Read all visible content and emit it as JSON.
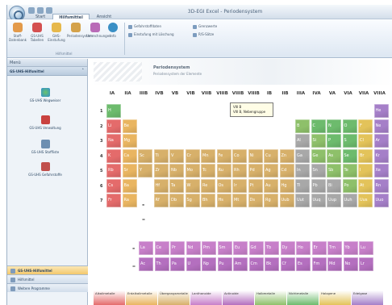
{
  "window": {
    "title": "3D-EGI Excel - Periodensystem"
  },
  "tabs": [
    "Start",
    "Hilfsmittel",
    "Ansicht"
  ],
  "ribbon": {
    "buttons": [
      "Stoff-Datenbank",
      "GS-UHS Tabellen",
      "GHS-Einstufung",
      "Periodensystem",
      "Umrechnungen",
      "Info"
    ],
    "small_buttons": [
      "Gefahrstoffdaten",
      "Einstufung mit Löschung",
      "Grenzwerte",
      "R/S-Sätze",
      "Datenblätter"
    ],
    "group_label": "Hilfsmittel"
  },
  "sidebar": {
    "header": "Menü",
    "category": "GS-UHS-Hilfsmittel",
    "items": [
      "GS-UHS Wegweiser",
      "GS-UHS Verwaltung",
      "GS-UHS Stoffliste",
      "GS-UHS Gefahrstoffe"
    ],
    "nav": [
      "GS-UHS-Hilfsmittel",
      "Hilfsmittel",
      "Weitere Programme"
    ]
  },
  "main": {
    "title": "Periodensystem",
    "subtitle": "Periodensystem der Elemente",
    "tooltip_line1": "VIII B",
    "tooltip_line2": "VIII B, Nebengruppe"
  },
  "table": {
    "groups": [
      "IA",
      "IIA",
      "IIIB",
      "IVB",
      "VB",
      "VIB",
      "VIIB",
      "VIIIB",
      "VIIIB",
      "VIIIB",
      "IB",
      "IIB",
      "IIIA",
      "IVA",
      "VA",
      "VIA",
      "VIIA",
      "VIIIA"
    ],
    "periods": [
      "1",
      "2",
      "3",
      "4",
      "5",
      "6",
      "7"
    ],
    "elements": [
      [
        "H",
        1,
        1,
        "nonmetal"
      ],
      [
        "He",
        1,
        18,
        "noble"
      ],
      [
        "Li",
        2,
        1,
        "alkali"
      ],
      [
        "Be",
        2,
        2,
        "alkaline"
      ],
      [
        "B",
        2,
        13,
        "metalloid"
      ],
      [
        "C",
        2,
        14,
        "nonmetal"
      ],
      [
        "N",
        2,
        15,
        "nonmetal"
      ],
      [
        "O",
        2,
        16,
        "nonmetal"
      ],
      [
        "F",
        2,
        17,
        "halogen"
      ],
      [
        "Ne",
        2,
        18,
        "noble"
      ],
      [
        "Na",
        3,
        1,
        "alkali"
      ],
      [
        "Mg",
        3,
        2,
        "alkaline"
      ],
      [
        "Al",
        3,
        13,
        "poor"
      ],
      [
        "Si",
        3,
        14,
        "metalloid"
      ],
      [
        "P",
        3,
        15,
        "nonmetal"
      ],
      [
        "S",
        3,
        16,
        "nonmetal"
      ],
      [
        "Cl",
        3,
        17,
        "halogen"
      ],
      [
        "Ar",
        3,
        18,
        "noble"
      ],
      [
        "K",
        4,
        1,
        "alkali"
      ],
      [
        "Ca",
        4,
        2,
        "alkaline"
      ],
      [
        "Sc",
        4,
        3,
        "transition"
      ],
      [
        "Ti",
        4,
        4,
        "transition"
      ],
      [
        "V",
        4,
        5,
        "transition"
      ],
      [
        "Cr",
        4,
        6,
        "transition"
      ],
      [
        "Mn",
        4,
        7,
        "transition"
      ],
      [
        "Fe",
        4,
        8,
        "transition"
      ],
      [
        "Co",
        4,
        9,
        "transition"
      ],
      [
        "Ni",
        4,
        10,
        "transition"
      ],
      [
        "Cu",
        4,
        11,
        "transition"
      ],
      [
        "Zn",
        4,
        12,
        "transition"
      ],
      [
        "Ga",
        4,
        13,
        "poor"
      ],
      [
        "Ge",
        4,
        14,
        "metalloid"
      ],
      [
        "As",
        4,
        15,
        "metalloid"
      ],
      [
        "Se",
        4,
        16,
        "nonmetal"
      ],
      [
        "Br",
        4,
        17,
        "halogen"
      ],
      [
        "Kr",
        4,
        18,
        "noble"
      ],
      [
        "Rb",
        5,
        1,
        "alkali"
      ],
      [
        "Sr",
        5,
        2,
        "alkaline"
      ],
      [
        "Y",
        5,
        3,
        "transition"
      ],
      [
        "Zr",
        5,
        4,
        "transition"
      ],
      [
        "Nb",
        5,
        5,
        "transition"
      ],
      [
        "Mo",
        5,
        6,
        "transition"
      ],
      [
        "Tc",
        5,
        7,
        "transition"
      ],
      [
        "Ru",
        5,
        8,
        "transition"
      ],
      [
        "Rh",
        5,
        9,
        "transition"
      ],
      [
        "Pd",
        5,
        10,
        "transition"
      ],
      [
        "Ag",
        5,
        11,
        "transition"
      ],
      [
        "Cd",
        5,
        12,
        "transition"
      ],
      [
        "In",
        5,
        13,
        "poor"
      ],
      [
        "Sn",
        5,
        14,
        "poor"
      ],
      [
        "Sb",
        5,
        15,
        "metalloid"
      ],
      [
        "Te",
        5,
        16,
        "metalloid"
      ],
      [
        "I",
        5,
        17,
        "halogen"
      ],
      [
        "Xe",
        5,
        18,
        "noble"
      ],
      [
        "Cs",
        6,
        1,
        "alkali"
      ],
      [
        "Ba",
        6,
        2,
        "alkaline"
      ],
      [
        "Hf",
        6,
        4,
        "transition"
      ],
      [
        "Ta",
        6,
        5,
        "transition"
      ],
      [
        "W",
        6,
        6,
        "transition"
      ],
      [
        "Re",
        6,
        7,
        "transition"
      ],
      [
        "Os",
        6,
        8,
        "transition"
      ],
      [
        "Ir",
        6,
        9,
        "transition"
      ],
      [
        "Pt",
        6,
        10,
        "transition"
      ],
      [
        "Au",
        6,
        11,
        "transition"
      ],
      [
        "Hg",
        6,
        12,
        "transition"
      ],
      [
        "Tl",
        6,
        13,
        "poor"
      ],
      [
        "Pb",
        6,
        14,
        "poor"
      ],
      [
        "Bi",
        6,
        15,
        "poor"
      ],
      [
        "Po",
        6,
        16,
        "metalloid"
      ],
      [
        "At",
        6,
        17,
        "halogen"
      ],
      [
        "Rn",
        6,
        18,
        "noble"
      ],
      [
        "Fr",
        7,
        1,
        "alkali"
      ],
      [
        "Ra",
        7,
        2,
        "alkaline"
      ],
      [
        "Rf",
        7,
        4,
        "transition"
      ],
      [
        "Db",
        7,
        5,
        "transition"
      ],
      [
        "Sg",
        7,
        6,
        "transition"
      ],
      [
        "Bh",
        7,
        7,
        "transition"
      ],
      [
        "Hs",
        7,
        8,
        "transition"
      ],
      [
        "Mt",
        7,
        9,
        "transition"
      ],
      [
        "Ds",
        7,
        10,
        "transition"
      ],
      [
        "Rg",
        7,
        11,
        "transition"
      ],
      [
        "Uub",
        7,
        12,
        "transition"
      ],
      [
        "Uut",
        7,
        13,
        "poor"
      ],
      [
        "Uuq",
        7,
        14,
        "poor"
      ],
      [
        "Uup",
        7,
        15,
        "poor"
      ],
      [
        "Uuh",
        7,
        16,
        "poor"
      ],
      [
        "Uus",
        7,
        17,
        "halogen"
      ],
      [
        "Uuo",
        7,
        18,
        "noble"
      ]
    ],
    "lanthanides": [
      "La",
      "Ce",
      "Pr",
      "Nd",
      "Pm",
      "Sm",
      "Eu",
      "Gd",
      "Tb",
      "Dy",
      "Ho",
      "Er",
      "Tm",
      "Yb",
      "Lu"
    ],
    "actinides": [
      "Ac",
      "Th",
      "Pa",
      "U",
      "Np",
      "Pu",
      "Am",
      "Cm",
      "Bk",
      "Cf",
      "Es",
      "Fm",
      "Md",
      "No",
      "Lr"
    ]
  },
  "legend": [
    "Alkalimetalle",
    "Erdalkalimetalle",
    "Übergangsmetalle",
    "Lanthanoide",
    "Actinoide",
    "Halbmetalle",
    "Nichtmetalle",
    "Halogene",
    "Edelgase"
  ],
  "colors": {
    "alkali": "#e46b6b",
    "alkaline": "#e9b561",
    "transition": "#d7b06a",
    "poor": "#a8a8a8",
    "metalloid": "#8ec06a",
    "nonmetal": "#6dbb6d",
    "halogen": "#e3c35a",
    "noble": "#a57fc8",
    "lanthanide": "#c77fc9",
    "actinide": "#b46fbf"
  }
}
